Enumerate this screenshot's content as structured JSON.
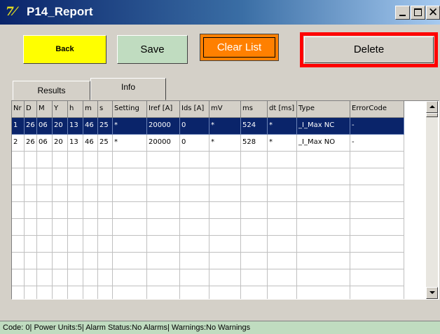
{
  "window": {
    "title": "P14_Report",
    "app_icon": "7f-icon",
    "minimize": "_",
    "maximize": "□",
    "close": "✕"
  },
  "toolbar": {
    "back_label": "Back",
    "save_label": "Save",
    "clear_label": "Clear List",
    "delete_label": "Delete",
    "colors": {
      "back": "#ffff00",
      "save": "#c0dcc0",
      "clear": "#ff8000",
      "delete_highlight": "#ff0000"
    }
  },
  "tabs": [
    {
      "label": "Results"
    },
    {
      "label": "Info"
    }
  ],
  "table": {
    "columns": [
      "Nr",
      "D",
      "M",
      "Y",
      "h",
      "m",
      "s",
      "Setting",
      "Iref [A]",
      "Ids [A]",
      "mV",
      "ms",
      "dt [ms]",
      "Type",
      "ErrorCode"
    ],
    "rows": [
      {
        "selected": true,
        "cells": [
          "1",
          "26",
          "06",
          "20",
          "13",
          "46",
          "25",
          "*",
          "20000",
          "0",
          "*",
          "524",
          "*",
          "_I_Max NC",
          "-"
        ]
      },
      {
        "selected": false,
        "cells": [
          "2",
          "26",
          "06",
          "20",
          "13",
          "46",
          "25",
          "*",
          "20000",
          "0",
          "*",
          "528",
          "*",
          "_I_Max NO",
          "-"
        ]
      }
    ],
    "empty_rows": 9,
    "selection_color": "#0a246a"
  },
  "statusbar": {
    "text": "Code: 0| Power Units:5| Alarm Status:No Alarms| Warnings:No Warnings",
    "color": "#c0dcc0"
  }
}
